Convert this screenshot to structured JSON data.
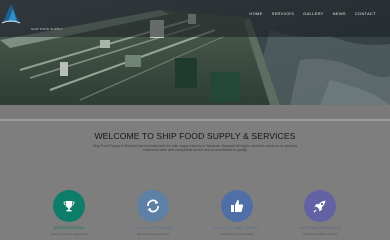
{
  "nav": {
    "logo_text": "SHIP FOOD SUPPLY",
    "items": [
      "HOME",
      "SERVICES",
      "GALLERY",
      "NEWS",
      "CONTACT"
    ]
  },
  "welcome": {
    "title": "WELCOME TO SHIP FOOD SUPPLY & SERVICES",
    "text": "Ship Food Supply & Services has revolutionised the ship supply industry in Sarawak, Malaysia striving to meet the needs of our growing customers base with exceptional service and a commitment to quality"
  },
  "features": [
    {
      "label": "EXPERIENCED",
      "icon": "trophy-icon",
      "circle_color": "#0d7d6a",
      "label_color": "#0a7060",
      "sub": "over 20 years of experience"
    },
    {
      "label": "TEAM RESPONSE",
      "icon": "refresh-icon",
      "circle_color": "#5d80a4",
      "label_color": "#566f8a",
      "sub": "fast team response 24/7"
    },
    {
      "label": "LOYALTY AND TRUST",
      "icon": "thumbs-up-icon",
      "circle_color": "#4f6fa6",
      "label_color": "#4f6a94",
      "sub": "trusted by our customers"
    },
    {
      "label": "FAST AND RELIABLE",
      "icon": "rocket-icon",
      "circle_color": "#6462a4",
      "label_color": "#5e5c92",
      "sub": "quick and reliable delivery"
    }
  ]
}
